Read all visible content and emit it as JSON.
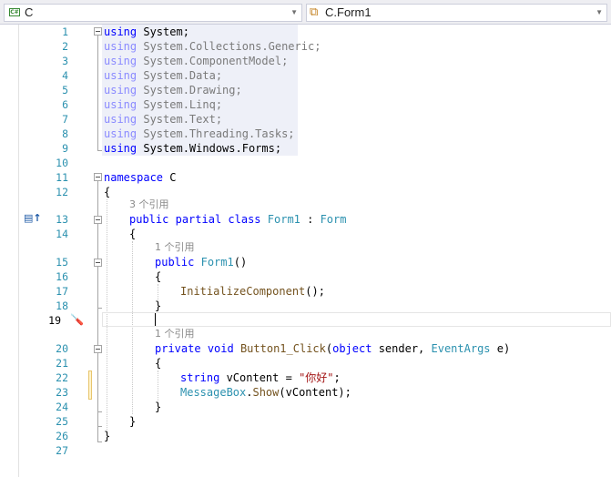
{
  "navbar": {
    "project_combo": "C",
    "class_combo": "C.Form1"
  },
  "codelens": {
    "class_refs": "3 个引用",
    "ctor_refs": "1 个引用",
    "click_refs": "1 个引用"
  },
  "lines": {
    "n1": "1",
    "n2": "2",
    "n3": "3",
    "n4": "4",
    "n5": "5",
    "n6": "6",
    "n7": "7",
    "n8": "8",
    "n9": "9",
    "n10": "10",
    "n11": "11",
    "n12": "12",
    "n13": "13",
    "n14": "14",
    "n15": "15",
    "n16": "16",
    "n17": "17",
    "n18": "18",
    "n19": "19",
    "n20": "20",
    "n21": "21",
    "n22": "22",
    "n23": "23",
    "n24": "24",
    "n25": "25",
    "n26": "26",
    "n27": "27"
  },
  "code": {
    "using_kw": "using",
    "ns1": "System;",
    "ns2": "System.Collections.Generic;",
    "ns3": "System.ComponentModel;",
    "ns4": "System.Data;",
    "ns5": "System.Drawing;",
    "ns6": "System.Linq;",
    "ns7": "System.Text;",
    "ns8": "System.Threading.Tasks;",
    "ns9": "System.Windows.Forms;",
    "namespace_kw": "namespace",
    "namespace_name": "C",
    "open_brace": "{",
    "close_brace": "}",
    "public_kw": "public",
    "partial_kw": "partial",
    "class_kw": "class",
    "class_name": "Form1",
    "colon": " : ",
    "base_class": "Form",
    "ctor_name": "Form1",
    "ctor_parens": "()",
    "init_call": "InitializeComponent",
    "init_tail": "();",
    "private_kw": "private",
    "void_kw": "void",
    "click_name": "Button1_Click",
    "click_open": "(",
    "object_kw": "object",
    "sender": " sender, ",
    "event_args": "EventArgs",
    "e_param": " e)",
    "string_kw": "string",
    "var_name": " vContent = ",
    "string_literal": "\"你好\"",
    "semicolon": ";",
    "messagebox": "MessageBox",
    "show_dot": ".",
    "show": "Show",
    "show_args": "(vContent);"
  },
  "icons": {
    "project": "csharp-project-icon",
    "class": "class-icon",
    "override": "override-indicator-icon",
    "quick_action": "quick-action-screwdriver-icon"
  }
}
